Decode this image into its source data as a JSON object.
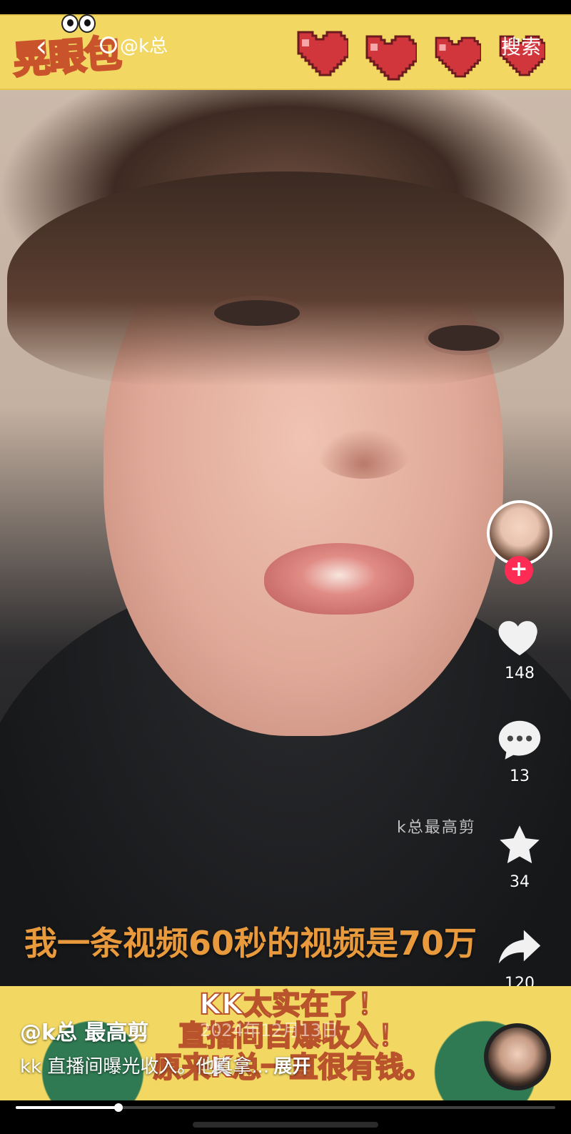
{
  "top_bar": {
    "logo_text": "晃眼包",
    "search_query": "@k总",
    "search_button": "搜索"
  },
  "video": {
    "caption": "我一条视频60秒的视频是70万",
    "watermark": "k总最高剪"
  },
  "actions": {
    "likes": "148",
    "comments": "13",
    "favorites": "34",
    "shares": "120"
  },
  "bottom": {
    "banner_lines": [
      "KK太实在了！",
      "直播间自爆收入！",
      "原来K总一直很有钱。"
    ],
    "date": "2024年12月13日",
    "author": "@k总 最高剪",
    "description": "kk 直播间曝光收入。他真拿...",
    "expand": "展开"
  },
  "progress": 0.19,
  "colors": {
    "banner_yellow": "#f2d863",
    "follow_red": "#fe2c55",
    "caption_orange": "#e89a3c"
  }
}
